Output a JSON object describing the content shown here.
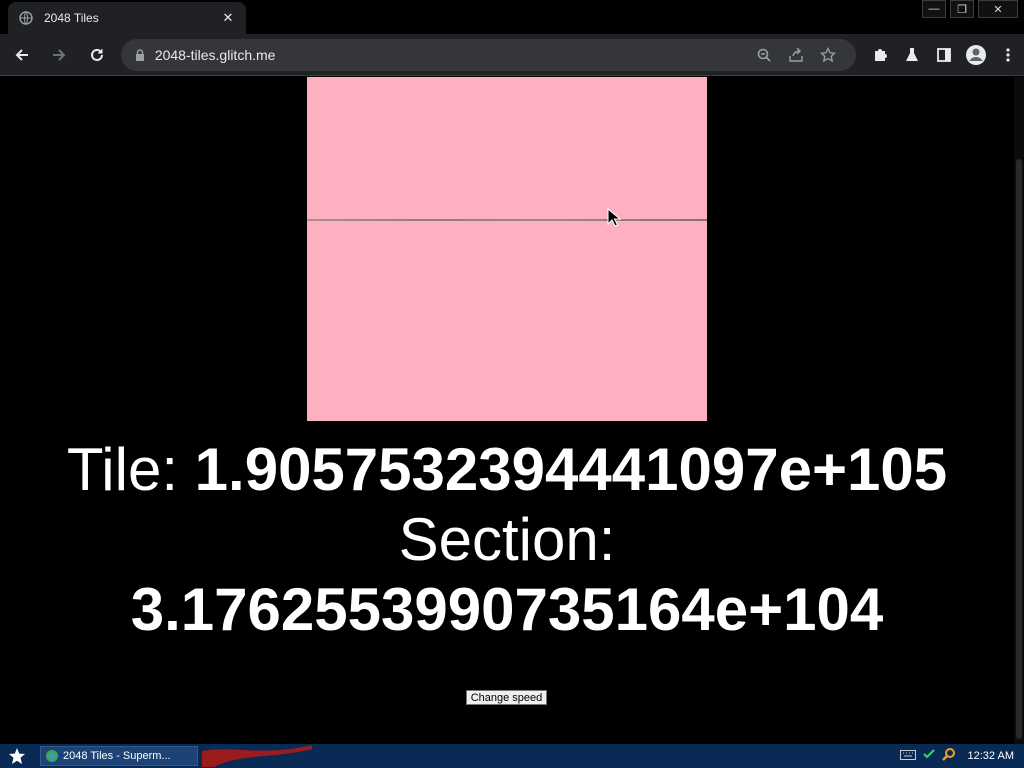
{
  "browser": {
    "tab_title": "2048 Tiles",
    "tab_favicon": "globe-icon",
    "url": "2048-tiles.glitch.me"
  },
  "page": {
    "canvas_color": "#ffb0c0",
    "tile_label": "Tile: ",
    "tile_value": "1.9057532394441097e+105",
    "section_label": "Section:",
    "section_value": "3.1762553990735164e+104",
    "speed_button": "Change speed"
  },
  "taskbar": {
    "task_label": "2048 Tiles - Superm...",
    "clock": "12:32 AM"
  },
  "colors": {
    "chrome_bg": "#202124",
    "omnibox_bg": "#35363a",
    "taskbar_bg": "#0a2a56"
  }
}
